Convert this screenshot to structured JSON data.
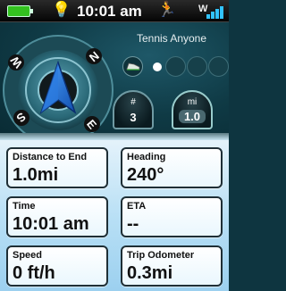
{
  "status_bar": {
    "time": "10:01 am",
    "battery_icon": "battery-icon",
    "light_icon": "lightbulb-icon",
    "activity_icon": "runner-icon",
    "signal_icon": "gps-signal-icon",
    "signal_letter": "W",
    "colors": {
      "battery": "#33c11f",
      "signal": "#31c3ff",
      "bulb": "#ffe02a"
    }
  },
  "compass": {
    "labels": {
      "n": "N",
      "e": "E",
      "s": "S",
      "w": "W"
    },
    "pointer_icon": "navigation-arrow-icon"
  },
  "profile": {
    "name": "Tennis Anyone",
    "selector_icon": "shoe-icon"
  },
  "stats": {
    "count_label": "#",
    "count_value": "3",
    "distance_label": "mi",
    "distance_value": "1.0"
  },
  "fields": [
    {
      "label": "Distance to End",
      "value": "1.0mi"
    },
    {
      "label": "Heading",
      "value": "240°"
    },
    {
      "label": "Time",
      "value": "10:01 am"
    },
    {
      "label": "ETA",
      "value": "--"
    },
    {
      "label": "Speed",
      "value": "0 ft/h"
    },
    {
      "label": "Trip Odometer",
      "value": "0.3mi"
    }
  ]
}
